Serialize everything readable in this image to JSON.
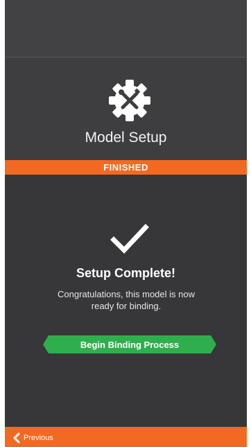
{
  "header": {
    "title": "Model Setup",
    "icon": "gear-wrench-icon"
  },
  "status": {
    "label": "FINISHED",
    "color": "#f26a22"
  },
  "content": {
    "icon": "checkmark-icon",
    "headline": "Setup Complete!",
    "message": "Congratulations, this model is now ready for binding."
  },
  "actions": {
    "begin_binding_label": "Begin Binding Process",
    "begin_binding_color": "#2fae4e"
  },
  "footer": {
    "previous_label": "Previous",
    "icon": "chevron-left-icon"
  }
}
